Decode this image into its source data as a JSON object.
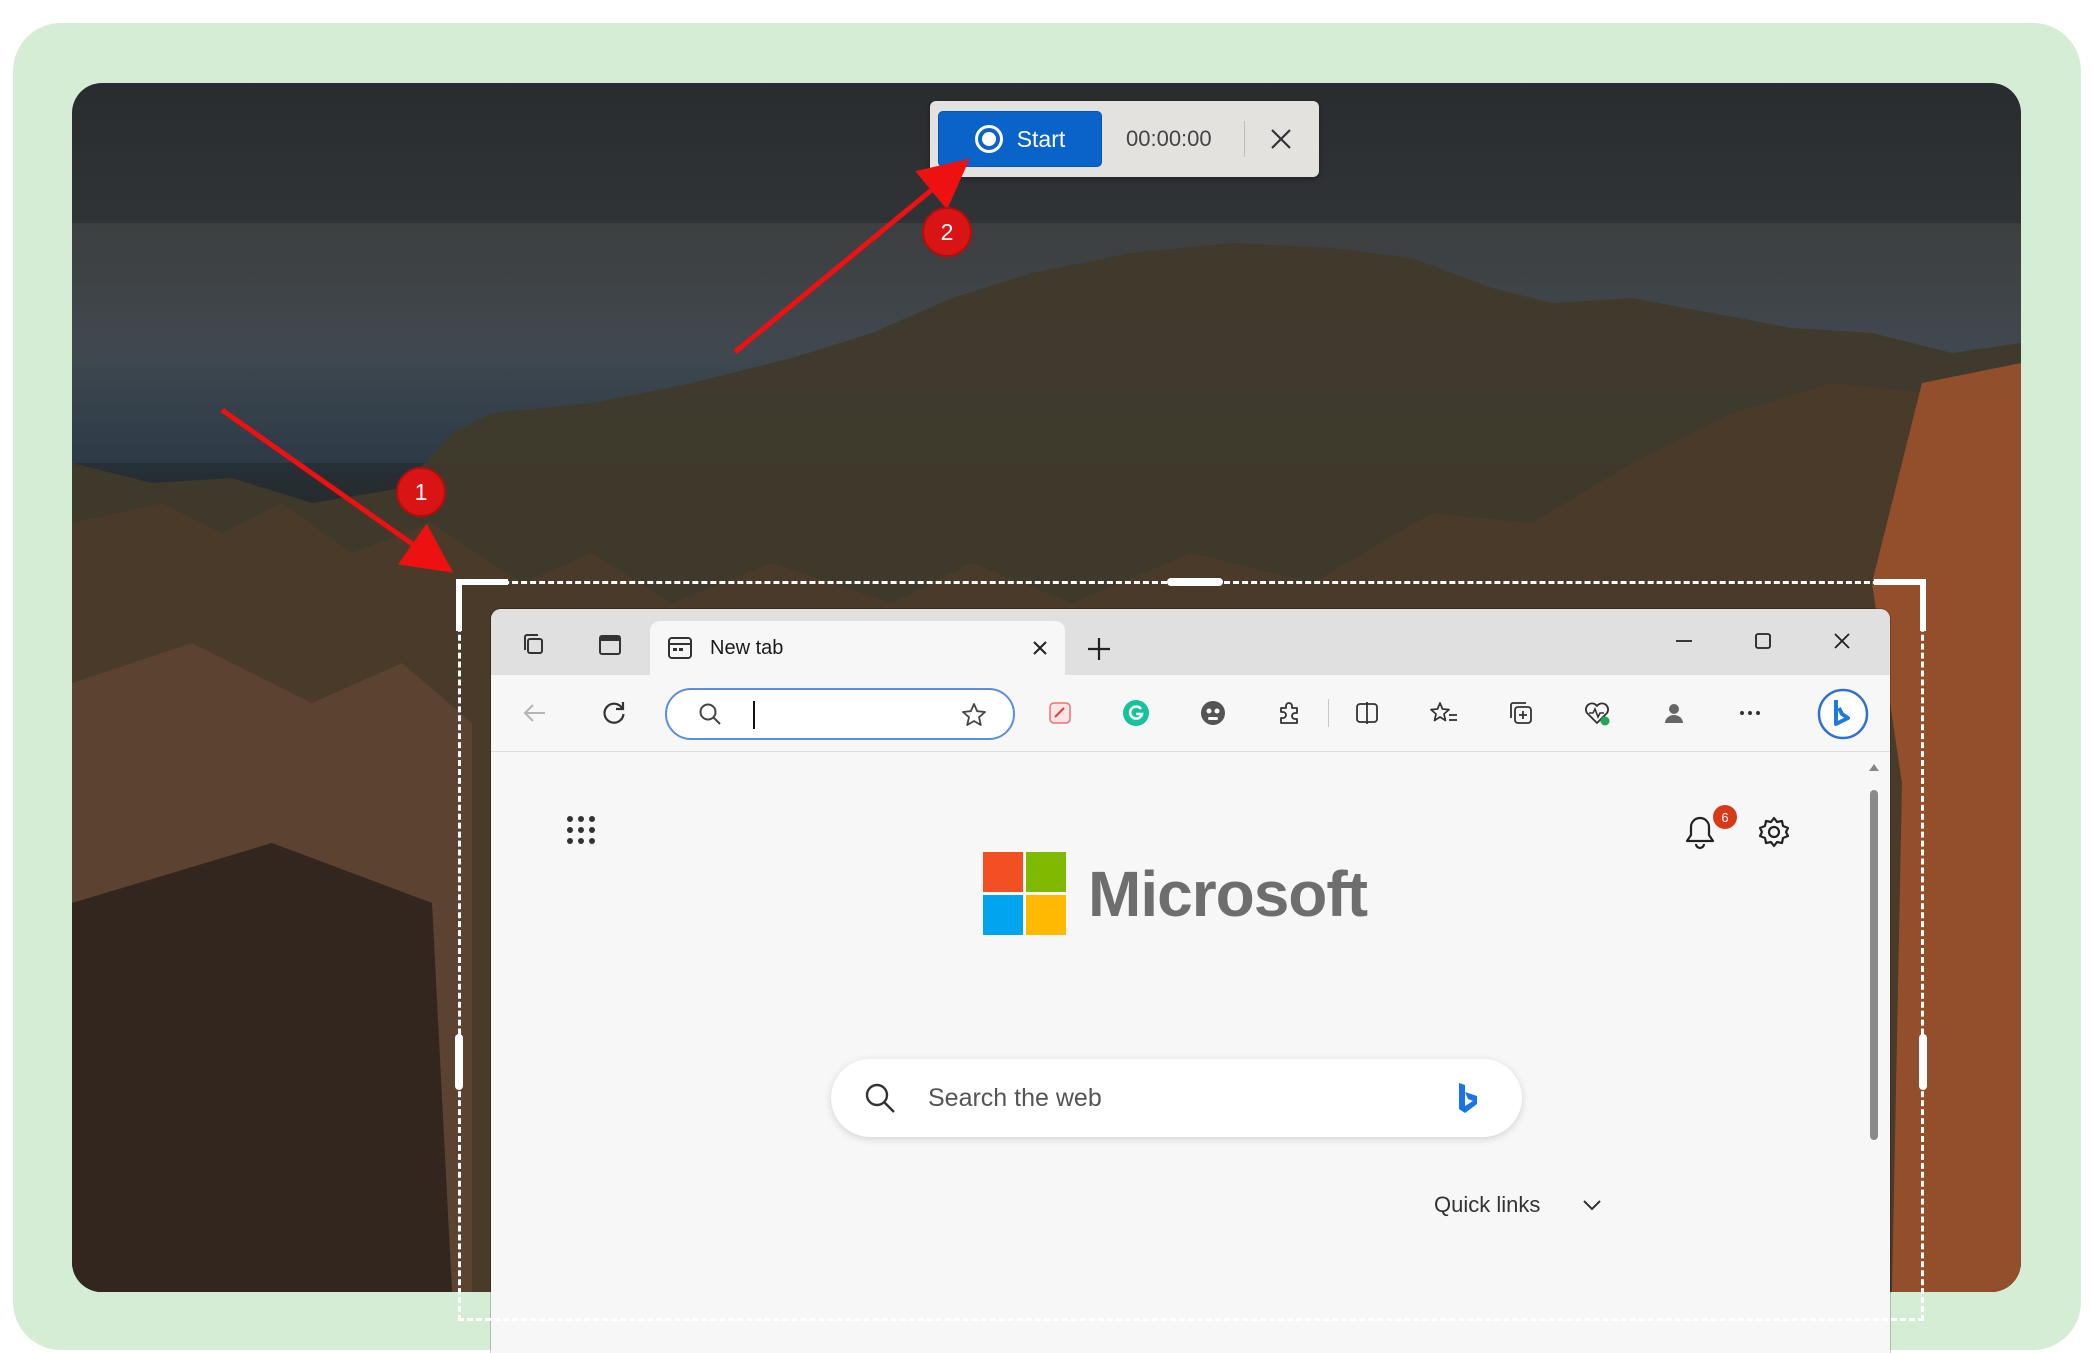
{
  "recorder": {
    "start_label": "Start",
    "timer": "00:00:00"
  },
  "annotations": {
    "step1": "1",
    "step2": "2"
  },
  "browser": {
    "tab_title": "New tab",
    "address_value": "",
    "brand_name": "Microsoft",
    "search_placeholder": "Search the web",
    "quick_links_label": "Quick links",
    "notification_count": "6"
  },
  "colors": {
    "frame": "#d5ecd5",
    "start_button": "#0a63c9",
    "annotation_red": "#d81414",
    "ms_red": "#f25022",
    "ms_green": "#7fba00",
    "ms_blue": "#00a4ef",
    "ms_yellow": "#ffb900"
  },
  "icons": [
    "record-icon",
    "close-icon",
    "workspaces-icon",
    "tab-actions-icon",
    "new-tab-page-icon",
    "plus-icon",
    "minimize-icon",
    "maximize-icon",
    "back-arrow-icon",
    "refresh-icon",
    "search-icon",
    "favorite-star-icon",
    "extension-icon",
    "split-screen-icon",
    "favorites-icon",
    "collections-icon",
    "browser-essentials-icon",
    "profile-icon",
    "more-icon",
    "copilot-icon",
    "apps-grid-icon",
    "bell-icon",
    "gear-icon",
    "bing-icon",
    "chevron-down-icon"
  ]
}
